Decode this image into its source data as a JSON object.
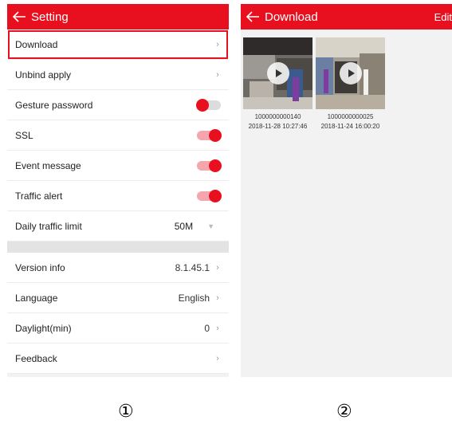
{
  "screen1": {
    "title": "Setting",
    "rows": [
      {
        "label": "Download",
        "value": "",
        "control": "chevron"
      },
      {
        "label": "Unbind apply",
        "value": "",
        "control": "chevron"
      },
      {
        "label": "Gesture password",
        "value": "",
        "control": "toggle",
        "state": "off"
      },
      {
        "label": "SSL",
        "value": "",
        "control": "toggle",
        "state": "on"
      },
      {
        "label": "Event message",
        "value": "",
        "control": "toggle",
        "state": "on"
      },
      {
        "label": "Traffic alert",
        "value": "",
        "control": "toggle",
        "state": "on"
      },
      {
        "label": "Daily traffic limit",
        "value": "50M",
        "control": "dropdown"
      }
    ],
    "rows2": [
      {
        "label": "Version info",
        "value": "8.1.45.1",
        "control": "chevron"
      },
      {
        "label": "Language",
        "value": "English",
        "control": "chevron"
      },
      {
        "label": "Daylight(min)",
        "value": "0",
        "control": "chevron"
      },
      {
        "label": "Feedback",
        "value": "",
        "control": "chevron"
      }
    ]
  },
  "screen2": {
    "title": "Download",
    "edit_label": "Edit",
    "items": [
      {
        "name": "1000000000140",
        "time": "2018-11-28 10:27:46"
      },
      {
        "name": "1000000000025",
        "time": "2018-11-24 16:00:20"
      }
    ]
  },
  "markers": [
    "①",
    "②"
  ],
  "colors": {
    "accent": "#e8101f",
    "toggle_track_on": "#f4a6ac",
    "toggle_track_off": "#dcdcdc"
  }
}
